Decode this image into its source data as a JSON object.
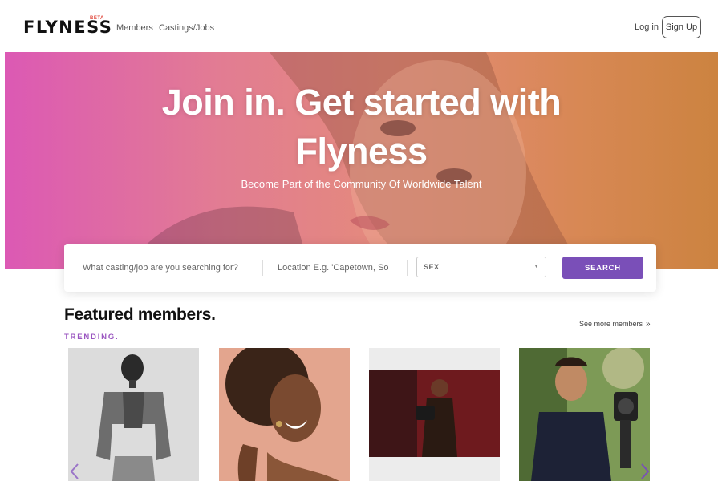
{
  "header": {
    "logo": "FLYNESS",
    "beta": "BETA",
    "nav": [
      "Members",
      "Castings/Jobs"
    ],
    "login": "Log in",
    "signup": "Sign Up"
  },
  "hero": {
    "title_line1": "Join in. Get started with",
    "title_line2": "Flyness",
    "subtitle": "Become Part of the Community Of Worldwide Talent"
  },
  "search": {
    "query_placeholder": "What casting/job are you searching for?",
    "location_placeholder": "Location E.g. 'Capetown, So",
    "sex_label": "SEX",
    "button": "SEARCH",
    "accent": "#7a4fb8"
  },
  "featured": {
    "title": "Featured members.",
    "trending": "TRENDING.",
    "see_more": "See more members",
    "members": [
      {
        "icon": "member-photo-man-denim-jacket"
      },
      {
        "icon": "member-photo-woman-smiling"
      },
      {
        "icon": "member-photo-woman-red-backdrop"
      },
      {
        "icon": "member-photo-man-camera"
      }
    ]
  }
}
